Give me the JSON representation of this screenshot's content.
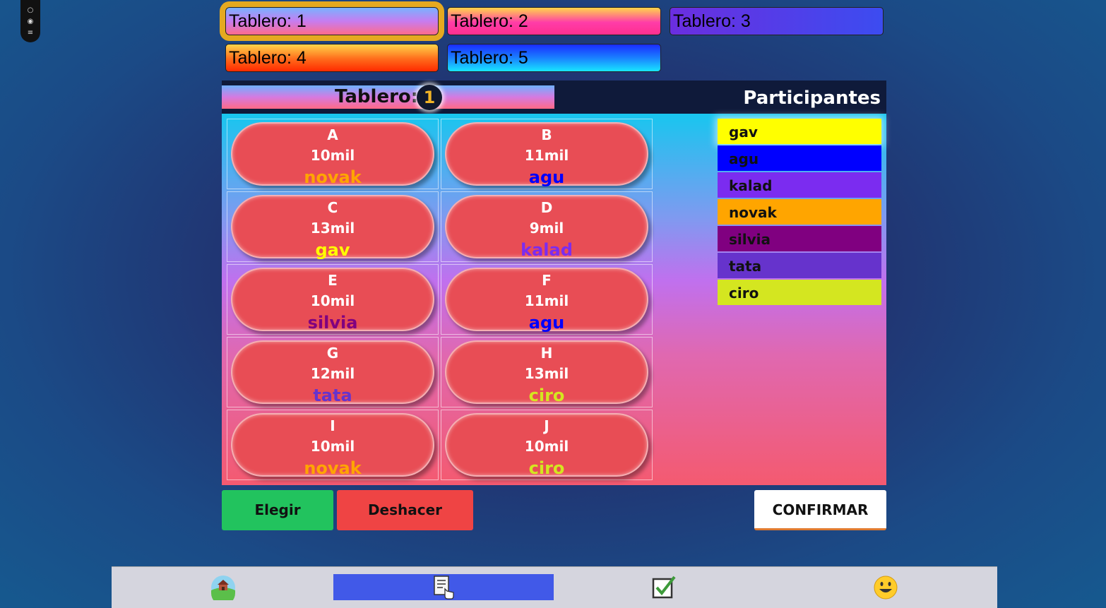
{
  "tabs": [
    {
      "label": "Tablero: 1",
      "active": true
    },
    {
      "label": "Tablero: 2",
      "active": false
    },
    {
      "label": "Tablero: 3",
      "active": false
    },
    {
      "label": "Tablero: 4",
      "active": false
    },
    {
      "label": "Tablero: 5",
      "active": false
    }
  ],
  "board": {
    "title": "Tablero:",
    "number": "1",
    "participants_title": "Participantes",
    "cells": [
      {
        "letter": "A",
        "price": "10mil",
        "owner": "novak",
        "owner_color": "#ffa500"
      },
      {
        "letter": "B",
        "price": "11mil",
        "owner": "agu",
        "owner_color": "#0000ff"
      },
      {
        "letter": "C",
        "price": "13mil",
        "owner": "gav",
        "owner_color": "#ffff00"
      },
      {
        "letter": "D",
        "price": "9mil",
        "owner": "kalad",
        "owner_color": "#7b2cf0"
      },
      {
        "letter": "E",
        "price": "10mil",
        "owner": "silvia",
        "owner_color": "#800080"
      },
      {
        "letter": "F",
        "price": "11mil",
        "owner": "agu",
        "owner_color": "#0000ff"
      },
      {
        "letter": "G",
        "price": "12mil",
        "owner": "tata",
        "owner_color": "#6633cc"
      },
      {
        "letter": "H",
        "price": "13mil",
        "owner": "ciro",
        "owner_color": "#d4e620"
      },
      {
        "letter": "I",
        "price": "10mil",
        "owner": "novak",
        "owner_color": "#ffa500"
      },
      {
        "letter": "J",
        "price": "10mil",
        "owner": "ciro",
        "owner_color": "#d4e620"
      }
    ]
  },
  "participants": [
    {
      "name": "gav",
      "color": "#ffff00"
    },
    {
      "name": "agu",
      "color": "#0000ff"
    },
    {
      "name": "kalad",
      "color": "#7b2cf0"
    },
    {
      "name": "novak",
      "color": "#ffa500"
    },
    {
      "name": "silvia",
      "color": "#800080"
    },
    {
      "name": "tata",
      "color": "#6633cc"
    },
    {
      "name": "ciro",
      "color": "#d4e620"
    }
  ],
  "actions": {
    "elegir": "Elegir",
    "deshacer": "Deshacer",
    "confirmar": "CONFIRMAR"
  },
  "bottom_nav": [
    {
      "icon": "landscape-icon",
      "active": false
    },
    {
      "icon": "checklist-hand-icon",
      "active": true
    },
    {
      "icon": "checkbox-check-icon",
      "active": false
    },
    {
      "icon": "smiley-icon",
      "active": false
    }
  ]
}
